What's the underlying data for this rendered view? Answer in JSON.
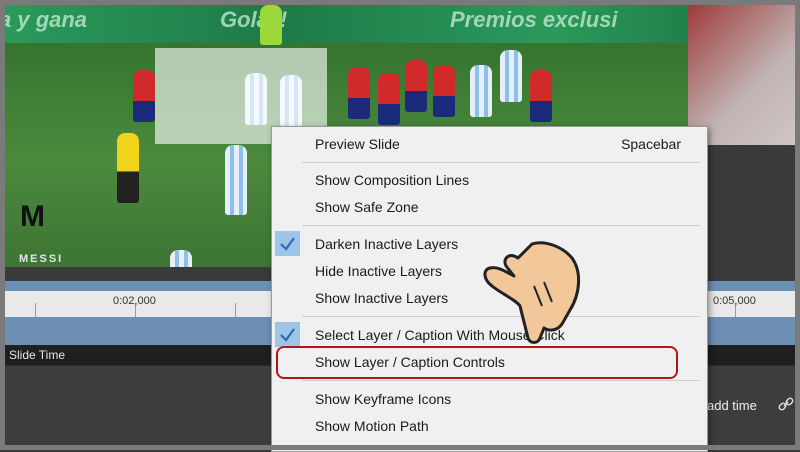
{
  "video": {
    "stands_text_left": "a y gana",
    "stands_text_mid": "Golaz!",
    "stands_text_right": "Premios exclusi",
    "logo_text": "M",
    "logo_subtext": "MESSI"
  },
  "timeline": {
    "ticks": [
      "0:02,000",
      "0:05,000"
    ],
    "slide_time_label": "Slide Time",
    "add_time_label": "add time"
  },
  "context_menu": {
    "items": [
      {
        "label": "Preview Slide",
        "shortcut": "Spacebar",
        "checked": false
      },
      {
        "label": "Show Composition Lines",
        "checked": false
      },
      {
        "label": "Show Safe Zone",
        "checked": false
      },
      {
        "label": "Darken Inactive Layers",
        "checked": true
      },
      {
        "label": "Hide Inactive Layers",
        "checked": false
      },
      {
        "label": "Show Inactive Layers",
        "checked": false
      },
      {
        "label": "Select Layer / Caption With Mouse Click",
        "checked": true
      },
      {
        "label": "Show Layer / Caption Controls",
        "checked": false,
        "highlighted": true
      },
      {
        "label": "Show Keyframe Icons",
        "checked": false
      },
      {
        "label": "Show Motion Path",
        "checked": false
      }
    ]
  },
  "colors": {
    "highlight_border": "#b01818",
    "check_bg": "#9cc5e8",
    "timeline_blue": "#6d8fb3"
  }
}
